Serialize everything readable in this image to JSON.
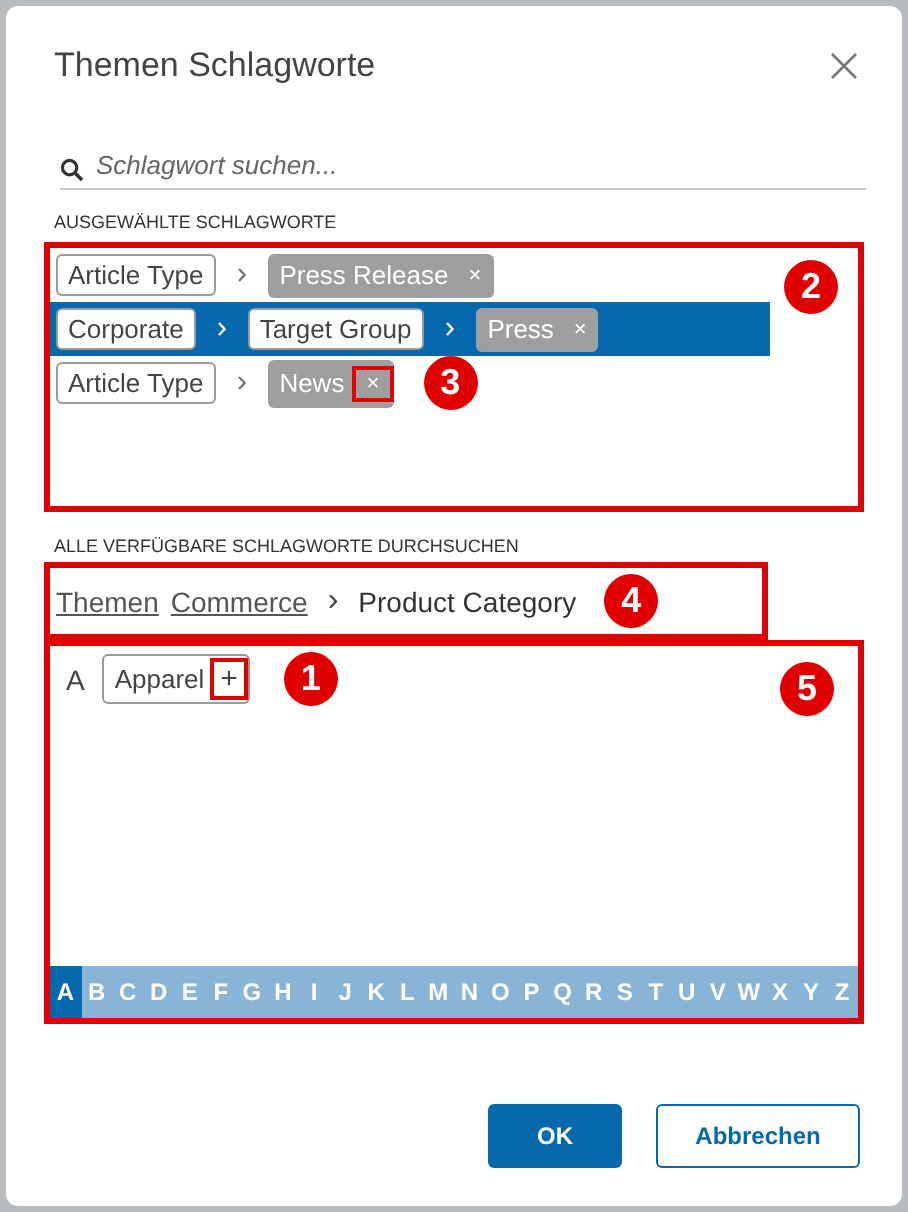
{
  "dialog": {
    "title": "Themen Schlagworte"
  },
  "search": {
    "placeholder": "Schlagwort suchen..."
  },
  "selected_section": {
    "label": "AUSGEWÄHLTE SCHLAGWORTE",
    "callout": "2",
    "rows": [
      {
        "selected": false,
        "path": [
          "Article Type"
        ],
        "tag": "Press Release",
        "remove": "×",
        "remove_callout": null
      },
      {
        "selected": true,
        "path": [
          "Corporate",
          "Target Group"
        ],
        "tag": "Press",
        "remove": "×",
        "remove_callout": null
      },
      {
        "selected": false,
        "path": [
          "Article Type"
        ],
        "tag": "News",
        "remove": "×",
        "remove_callout": "3"
      }
    ]
  },
  "browse_section": {
    "label": "ALLE VERFÜGBARE SCHLAGWORTE DURCHSUCHEN",
    "breadcrumb": {
      "callout": "4",
      "links": [
        "Themen",
        "Commerce"
      ],
      "separator": "›",
      "current": "Product Category"
    },
    "browser": {
      "callout": "5",
      "groups": [
        {
          "letter": "A",
          "items": [
            {
              "label": "Apparel",
              "add": "+",
              "add_callout": "1"
            }
          ]
        }
      ],
      "alphabet": [
        {
          "letter": "A",
          "selected": true
        },
        {
          "letter": "B",
          "selected": false
        },
        {
          "letter": "C",
          "selected": false
        },
        {
          "letter": "D",
          "selected": false
        },
        {
          "letter": "E",
          "selected": false
        },
        {
          "letter": "F",
          "selected": false
        },
        {
          "letter": "G",
          "selected": false
        },
        {
          "letter": "H",
          "selected": false
        },
        {
          "letter": "I",
          "selected": false
        },
        {
          "letter": "J",
          "selected": false
        },
        {
          "letter": "K",
          "selected": false
        },
        {
          "letter": "L",
          "selected": false
        },
        {
          "letter": "M",
          "selected": false
        },
        {
          "letter": "N",
          "selected": false
        },
        {
          "letter": "O",
          "selected": false
        },
        {
          "letter": "P",
          "selected": false
        },
        {
          "letter": "Q",
          "selected": false
        },
        {
          "letter": "R",
          "selected": false
        },
        {
          "letter": "S",
          "selected": false
        },
        {
          "letter": "T",
          "selected": false
        },
        {
          "letter": "U",
          "selected": false
        },
        {
          "letter": "V",
          "selected": false
        },
        {
          "letter": "W",
          "selected": false
        },
        {
          "letter": "X",
          "selected": false
        },
        {
          "letter": "Y",
          "selected": false
        },
        {
          "letter": "Z",
          "selected": false
        }
      ]
    }
  },
  "buttons": [
    {
      "label": "OK",
      "kind": "primary"
    },
    {
      "label": "Abbrechen",
      "kind": "secondary"
    }
  ]
}
